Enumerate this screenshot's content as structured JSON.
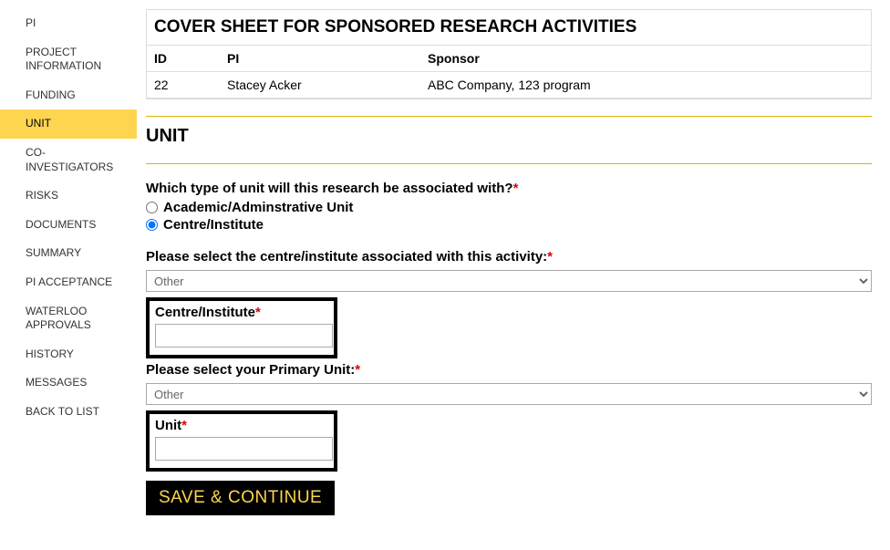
{
  "sidebar": {
    "items": [
      {
        "label": "PI",
        "active": false
      },
      {
        "label": "PROJECT INFORMATION",
        "active": false
      },
      {
        "label": "FUNDING",
        "active": false
      },
      {
        "label": "UNIT",
        "active": true
      },
      {
        "label": "CO-INVESTIGATORS",
        "active": false
      },
      {
        "label": "RISKS",
        "active": false
      },
      {
        "label": "DOCUMENTS",
        "active": false
      },
      {
        "label": "SUMMARY",
        "active": false
      },
      {
        "label": "PI ACCEPTANCE",
        "active": false
      },
      {
        "label": "WATERLOO APPROVALS",
        "active": false
      },
      {
        "label": "HISTORY",
        "active": false
      },
      {
        "label": "MESSAGES",
        "active": false
      },
      {
        "label": "BACK TO LIST",
        "active": false
      }
    ]
  },
  "header": {
    "title": "COVER SHEET FOR SPONSORED RESEARCH ACTIVITIES",
    "cols": {
      "id": "ID",
      "pi": "PI",
      "sponsor": "Sponsor"
    },
    "row": {
      "id": "22",
      "pi": "Stacey Acker",
      "sponsor": "ABC Company, 123 program"
    }
  },
  "section": {
    "heading": "UNIT",
    "q1": "Which type of unit will this research be associated with?",
    "opt1": "Academic/Adminstrative Unit",
    "opt2": "Centre/Institute",
    "q2": "Please select the centre/institute associated with this activity:",
    "select_other": "Other",
    "ci_label": "Centre/Institute",
    "q3": "Please select your Primary Unit:",
    "unit_label": "Unit",
    "save": "SAVE & CONTINUE"
  }
}
